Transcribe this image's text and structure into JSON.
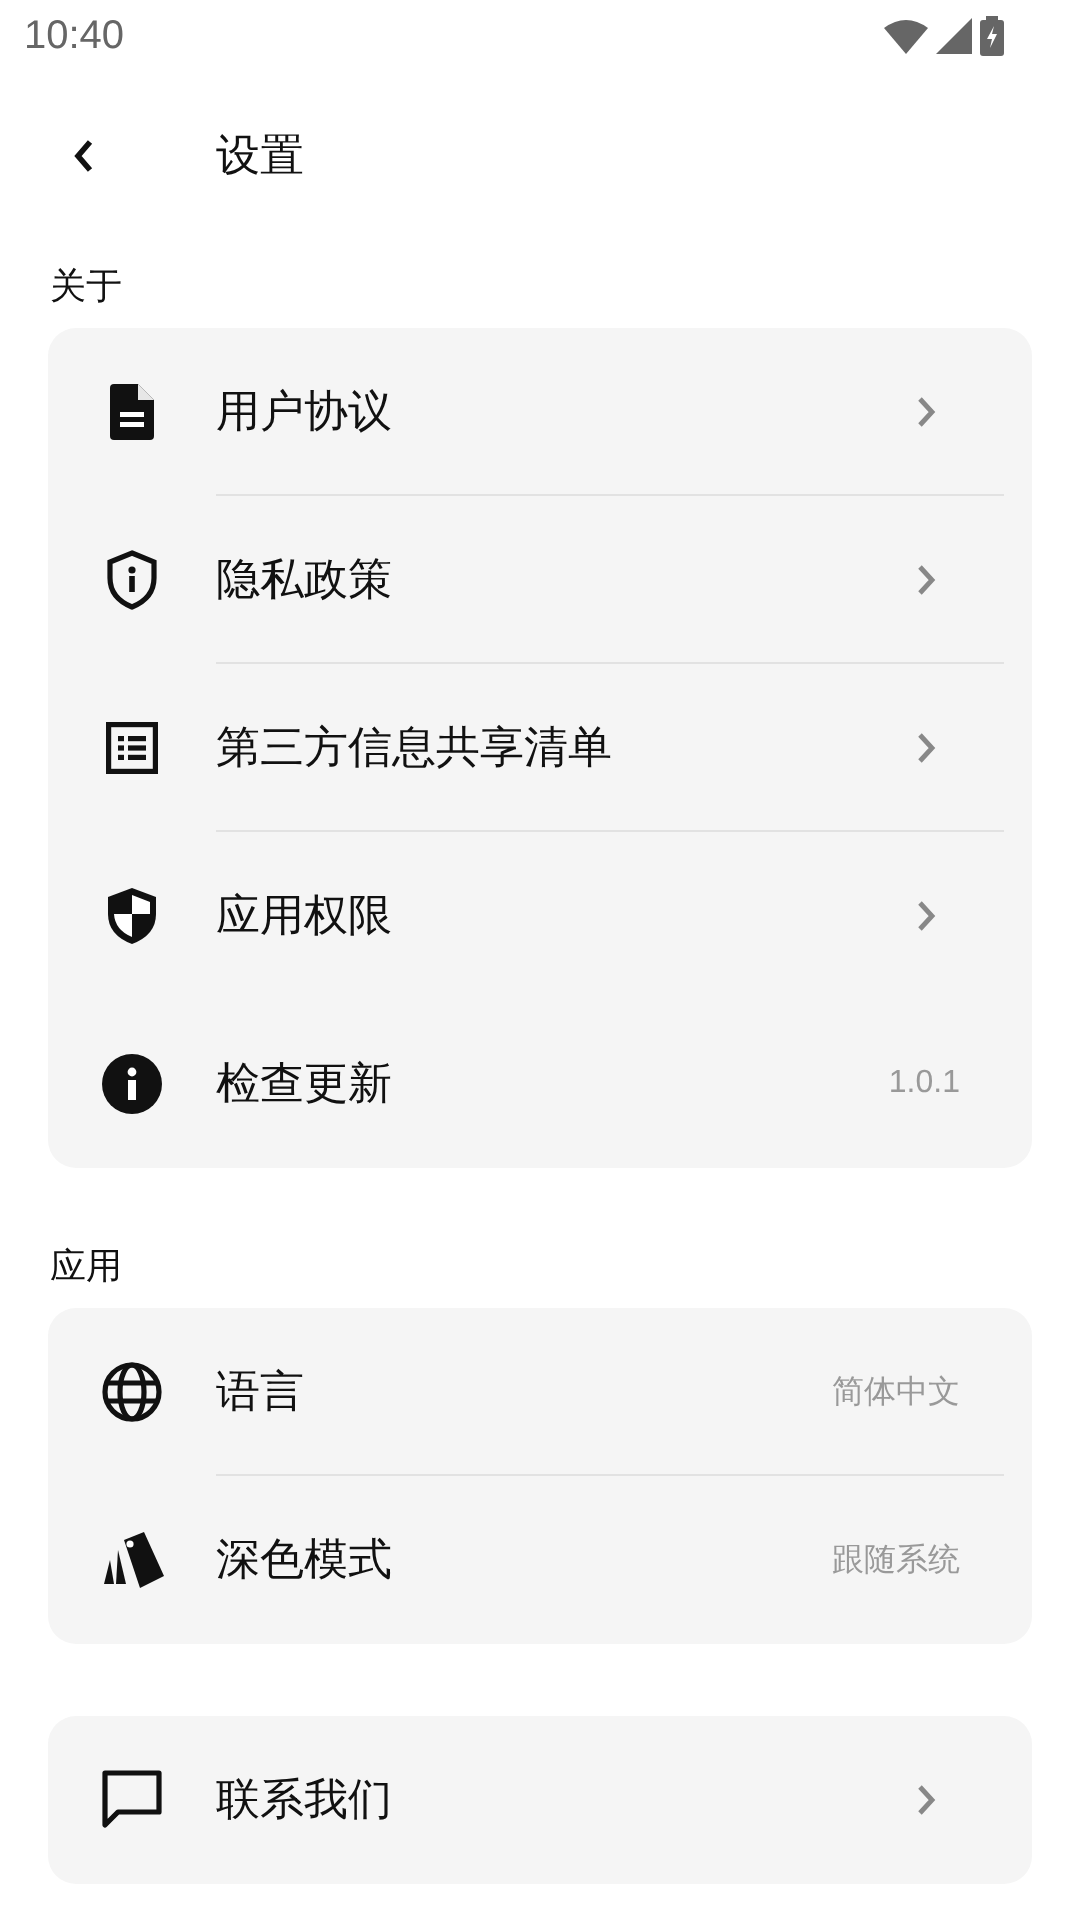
{
  "status_bar": {
    "time": "10:40"
  },
  "header": {
    "title": "设置"
  },
  "sections": [
    {
      "title": "关于",
      "items": [
        {
          "label": "用户协议",
          "trailing": {
            "kind": "chevron"
          },
          "divider_below": true
        },
        {
          "label": "隐私政策",
          "trailing": {
            "kind": "chevron"
          },
          "divider_below": true
        },
        {
          "label": "第三方信息共享清单",
          "trailing": {
            "kind": "chevron"
          },
          "divider_below": true
        },
        {
          "label": "应用权限",
          "trailing": {
            "kind": "chevron"
          },
          "divider_below": false
        },
        {
          "label": "检查更新",
          "trailing": {
            "kind": "value",
            "text": "1.0.1"
          },
          "divider_below": false
        }
      ]
    },
    {
      "title": "应用",
      "items": [
        {
          "label": "语言",
          "trailing": {
            "kind": "value",
            "text": "简体中文"
          },
          "divider_below": true
        },
        {
          "label": "深色模式",
          "trailing": {
            "kind": "value",
            "text": "跟随系统"
          },
          "divider_below": false
        }
      ]
    },
    {
      "items": [
        {
          "label": "联系我们",
          "trailing": {
            "kind": "chevron"
          },
          "divider_below": false
        }
      ]
    }
  ]
}
